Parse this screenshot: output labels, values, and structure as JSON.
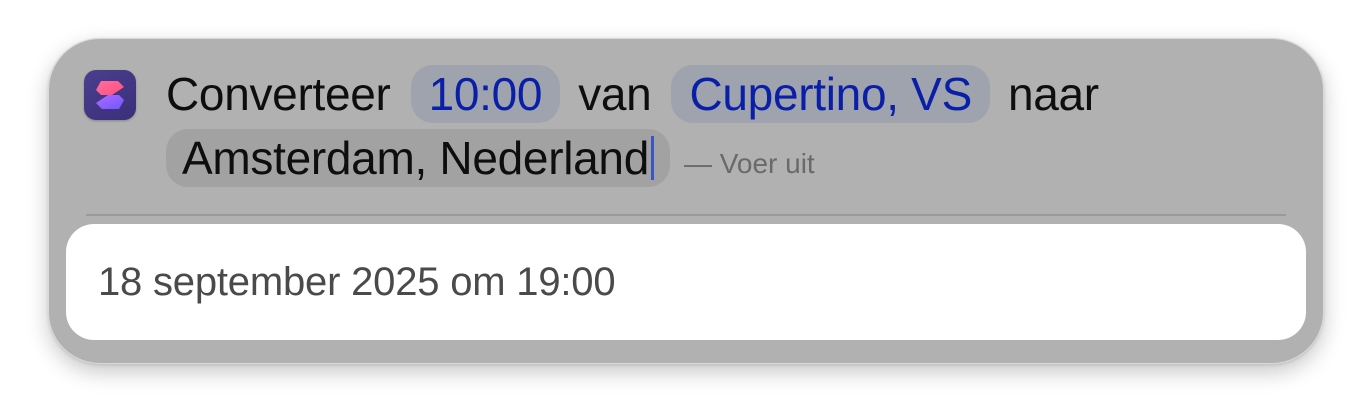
{
  "app": {
    "icon": "shortcuts-icon",
    "icon_colors": {
      "background": "#3f357f",
      "glyph_top": "#ff5f8f",
      "glyph_bottom": "#8a5cff"
    }
  },
  "query": {
    "word_convert": "Converteer",
    "time_token": "10:00",
    "word_from": "van",
    "from_location_token": "Cupertino, VS",
    "word_to": "naar",
    "to_location_token": "Amsterdam, Nederland",
    "run_hint": "— Voer uit"
  },
  "result": {
    "text": "18 september 2025 om 19:00"
  },
  "colors": {
    "panel_background": "#b1b1b1",
    "token_background": "#9fa3ad",
    "token_text": "#0a1fa8",
    "caret": "#3a55c4"
  }
}
